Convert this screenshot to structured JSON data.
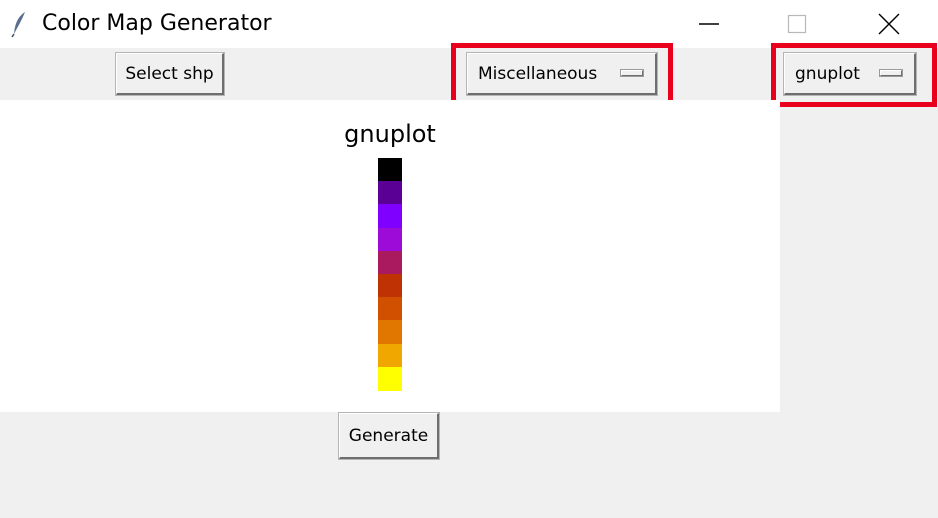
{
  "window": {
    "title": "Color Map Generator",
    "icon": "feather-icon",
    "controls": [
      "minimize-icon",
      "maximize-icon",
      "close-icon"
    ]
  },
  "toolbar": {
    "select_shp_label": "Select shp",
    "category_menu": {
      "selected": "Miscellaneous"
    },
    "colormap_menu": {
      "selected": "gnuplot"
    },
    "highlight_color": "#e8001c"
  },
  "preview": {
    "colormap_name": "gnuplot",
    "swatch_colors": [
      "#000000",
      "#5a0095",
      "#7f00ff",
      "#9c0bd7",
      "#aa1a5e",
      "#bf3203",
      "#d15000",
      "#e27700",
      "#f0a800",
      "#ffff00"
    ]
  },
  "actions": {
    "generate_label": "Generate"
  }
}
